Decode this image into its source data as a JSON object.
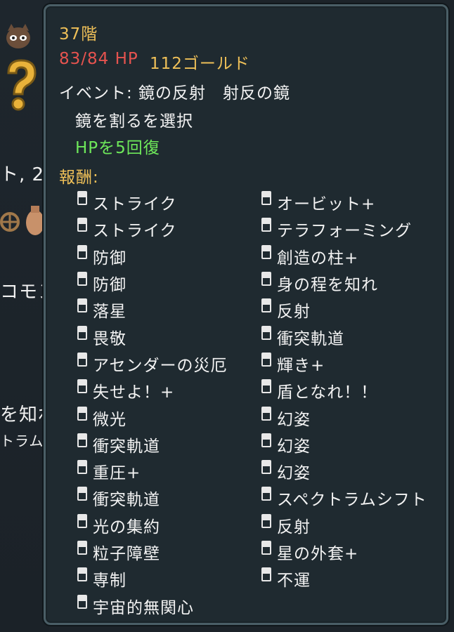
{
  "background": {
    "left_text_1": "ト, 2",
    "left_text_2": "コモン",
    "left_text_3": "を知れ",
    "left_text_4": "トラムシ",
    "icons": [
      "mask-icon",
      "question-icon",
      "wheel-icon",
      "pouch-icon"
    ]
  },
  "tooltip": {
    "floor": "37階",
    "hp": "83/84 HP",
    "gold": "112ゴールド",
    "event": "イベント: 鏡の反射　射反の鏡",
    "choice": "鏡を割るを選択",
    "effect": "HPを5回復",
    "rewards_label": "報酬:",
    "rewards_left": [
      "ストライク",
      "ストライク",
      "防御",
      "防御",
      "落星",
      "畏敬",
      "アセンダーの災厄",
      "失せよ！+",
      "微光",
      "衝突軌道",
      "重圧+",
      "衝突軌道",
      "光の集約",
      "粒子障壁",
      "専制",
      "宇宙的無関心"
    ],
    "rewards_right": [
      "オービット+",
      "テラフォーミング",
      "創造の柱+",
      "身の程を知れ",
      "反射",
      "衝突軌道",
      "輝き+",
      "盾となれ！！",
      "幻姿",
      "幻姿",
      "幻姿",
      "スペクトラムシフト",
      "反射",
      "星の外套+",
      "不運"
    ]
  },
  "colors": {
    "gold": "#efc058",
    "red": "#e6534f",
    "green": "#6ee85a",
    "panel_bg": "#1f2a30",
    "panel_border": "#4a5e66"
  }
}
